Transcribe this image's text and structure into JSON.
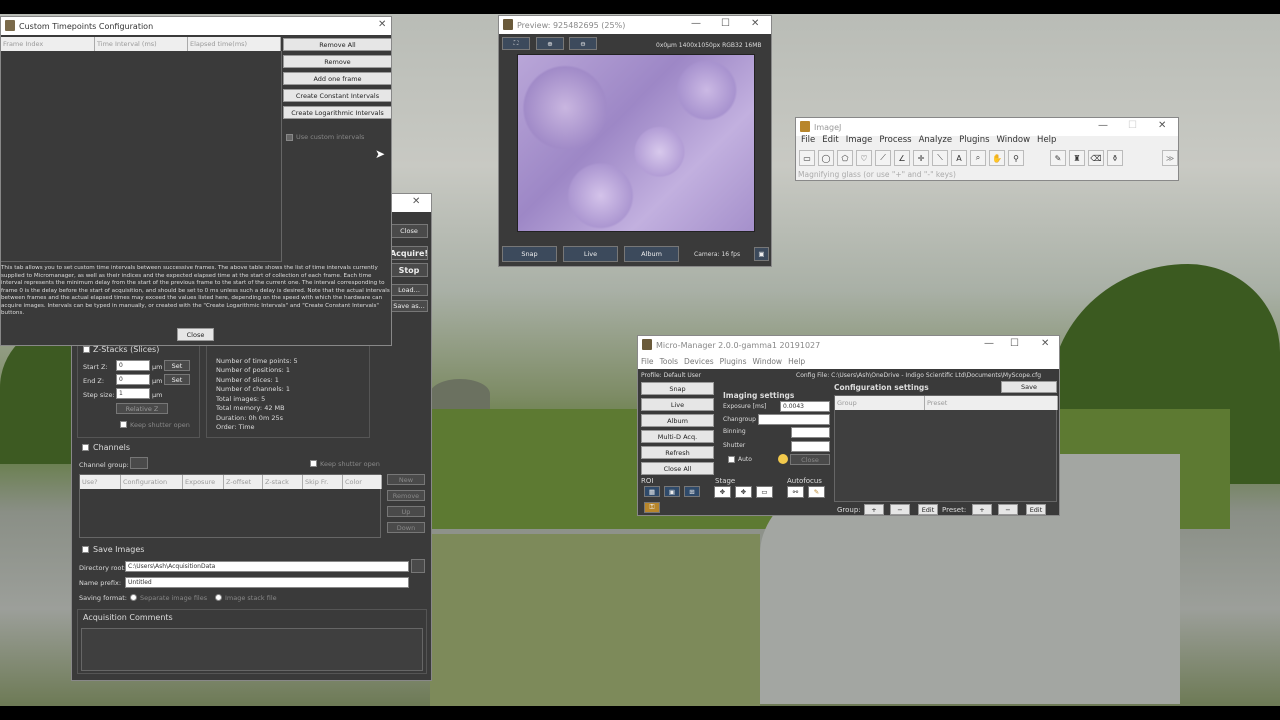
{
  "timepoints": {
    "title": "Custom Timepoints Configuration",
    "columns": [
      "Frame Index",
      "Time Interval (ms)",
      "Elapsed time(ms)"
    ],
    "buttons": [
      "Remove All",
      "Remove",
      "Add one frame",
      "Create Constant Intervals",
      "Create Logarithmic Intervals"
    ],
    "use_custom": "Use custom intervals",
    "help": "This tab allows you to set custom time intervals between successive frames. The above table shows the list of time intervals currently supplied to Micromanager, as well as their indices and the expected elapsed time at the start of collection of each frame. Each time interval represents the minimum delay from the start of the previous frame to the start of the current one. The interval corresponding to frame 0 is the delay before the start of acquisition, and should be set to 0 ms unless such a delay is desired. Note that the actual intervals between frames and the actual elapsed times may exceed the values listed here, depending on the speed with which the hardware can acquire images. Intervals can be typed in manually, or created with the \"Create Logarithmic Intervals\" and \"Create Constant Intervals\" buttons.",
    "close": "Close"
  },
  "mda": {
    "side_buttons": [
      "Close",
      "Acquire!",
      "Stop",
      "Load...",
      "Save as..."
    ],
    "zstacks": {
      "label": "Z-Stacks (Slices)",
      "start_label": "Start Z:",
      "start_value": "0",
      "end_label": "End Z:",
      "end_value": "0",
      "step_label": "Step size:",
      "step_value": "1",
      "unit": "µm",
      "set": "Set",
      "relative": "Relative Z",
      "keep_shutter": "Keep shutter open"
    },
    "summary": [
      "Number of time points: 5",
      "Number of positions: 1",
      "Number of slices: 1",
      "Number of channels: 1",
      "Total images: 5",
      "Total memory: 42 MB",
      "Duration: 0h 0m 25s",
      "Order: Time"
    ],
    "channels": {
      "label": "Channels",
      "group_label": "Channel group:",
      "keep_shutter": "Keep shutter open",
      "columns": [
        "Use?",
        "Configuration",
        "Exposure",
        "Z-offset",
        "Z-stack",
        "Skip Fr.",
        "Color"
      ],
      "buttons": [
        "New",
        "Remove",
        "Up",
        "Down"
      ]
    },
    "save": {
      "label": "Save Images",
      "dir_label": "Directory root:",
      "dir_value": "C:\\Users\\Ash\\AcquisitionData",
      "prefix_label": "Name prefix:",
      "prefix_value": "Untitled",
      "format_label": "Saving format:",
      "opt1": "Separate image files",
      "opt2": "Image stack file"
    },
    "comments": "Acquisition Comments"
  },
  "preview": {
    "title": "Preview: 925482695 (25%)",
    "info": "0x0µm  1400x1050px  RGB32  16MB",
    "buttons": [
      "Snap",
      "Live",
      "Album"
    ],
    "camera": "Camera: 16 fps"
  },
  "imagej": {
    "title": "ImageJ",
    "menu": [
      "File",
      "Edit",
      "Image",
      "Process",
      "Analyze",
      "Plugins",
      "Window",
      "Help"
    ],
    "status": "Magnifying glass (or use \"+\" and \"-\" keys)",
    "tools": [
      "rectangle-icon",
      "oval-icon",
      "polygon-icon",
      "freehand-icon",
      "line-icon",
      "angle-icon",
      "point-icon",
      "wand-icon",
      "text-icon",
      "magnifier-icon",
      "hand-icon",
      "dropper-icon",
      "pencil-icon",
      "brush-icon",
      "eraser-icon",
      "fill-icon",
      "more-icon"
    ]
  },
  "mm": {
    "title": "Micro-Manager 2.0.0-gamma1 20191027",
    "menu": [
      "File",
      "Tools",
      "Devices",
      "Plugins",
      "Window",
      "Help"
    ],
    "profile": "Profile: Default User",
    "config_file": "Config File: C:\\Users\\Ash\\OneDrive - Indigo Scientific Ltd\\Documents\\MyScope.cfg",
    "left_buttons": [
      "Snap",
      "Live",
      "Album",
      "Multi-D Acq.",
      "Refresh",
      "Close All"
    ],
    "imaging": "Imaging settings",
    "exposure_label": "Exposure [ms]",
    "exposure_value": "0.0043",
    "changroup": "Changroup",
    "binning": "Binning",
    "shutter": "Shutter",
    "auto": "Auto",
    "close": "Close",
    "config": "Configuration settings",
    "save": "Save",
    "group_col": "Group",
    "preset_col": "Preset",
    "roi": "ROI",
    "stage": "Stage",
    "autofocus": "Autofocus",
    "group_label": "Group:",
    "preset_label": "Preset:",
    "edit": "Edit",
    "plus": "+",
    "minus": "−"
  }
}
